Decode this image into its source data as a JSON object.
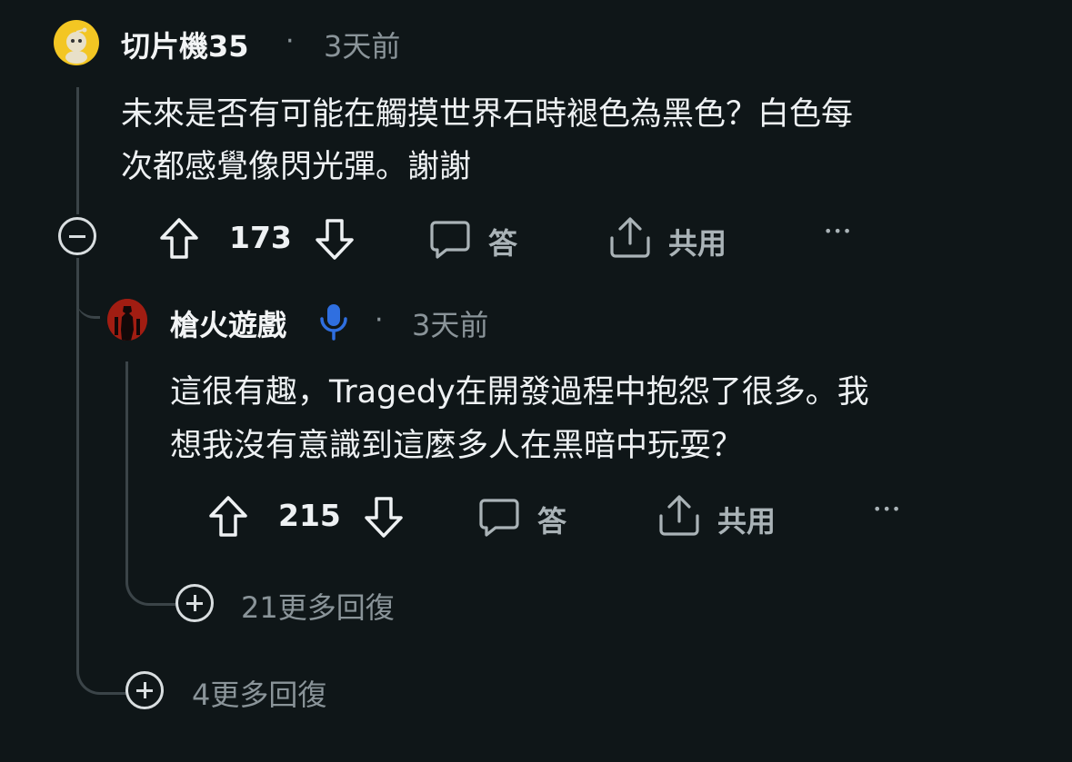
{
  "comment": {
    "author": "切片機35",
    "separator": "·",
    "time": "3天前",
    "body_line1": "未來是否有可能在觸摸世界石時褪色為黑色？白色每",
    "body_line2": "次都感覺像閃光彈。謝謝",
    "score": "173",
    "reply_label": "答",
    "share_label": "共用",
    "more_label": "•••",
    "more_replies": "4更多回復"
  },
  "reply": {
    "author": "槍火遊戲",
    "separator": "·",
    "time": "3天前",
    "body_line1": "這很有趣，Tragedy在開發過程中抱怨了很多。我",
    "body_line2": "想我沒有意識到這麼多人在黑暗中玩耍？",
    "score": "215",
    "reply_label": "答",
    "share_label": "共用",
    "more_label": "•••",
    "more_replies": "21更多回復"
  },
  "colors": {
    "background": "#0f1618",
    "text": "#eef1f3",
    "muted": "#8a9499",
    "thread_line": "#3b4448",
    "mod_badge": "#2f6fe0",
    "avatar_yellow": "#f3c623"
  }
}
